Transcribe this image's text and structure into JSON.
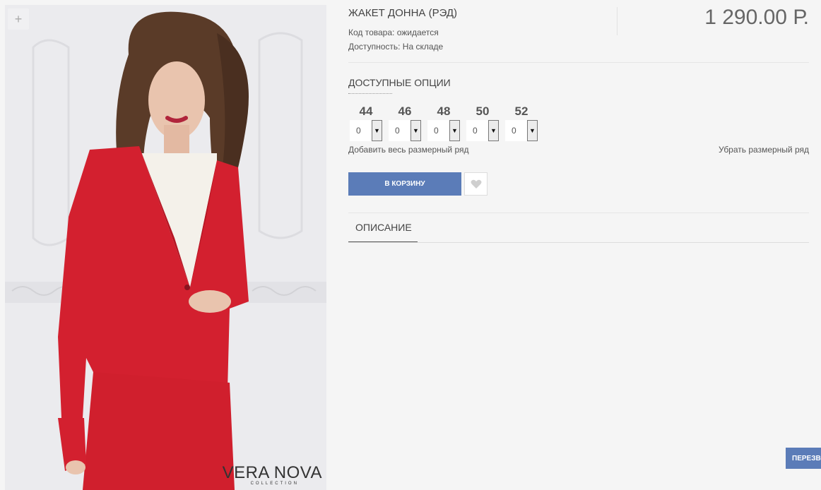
{
  "product": {
    "title": "ЖАКЕТ ДОННА (РЭД)",
    "sku": "Код товара: ожидается",
    "availability": "Доступность: На складе",
    "price": "1 290.00 Р."
  },
  "gallery": {
    "zoom_label": "+",
    "watermark_brand": "VERA NOVA",
    "watermark_sub": "COLLECTION"
  },
  "options": {
    "title": "ДОСТУПНЫЕ ОПЦИИ",
    "sizes": [
      {
        "label": "44",
        "qty": "0"
      },
      {
        "label": "46",
        "qty": "0"
      },
      {
        "label": "48",
        "qty": "0"
      },
      {
        "label": "50",
        "qty": "0"
      },
      {
        "label": "52",
        "qty": "0"
      }
    ],
    "add_all_label": "Добавить весь размерный ряд",
    "remove_all_label": "Убрать размерный ряд"
  },
  "actions": {
    "cart_label": "В КОРЗИНУ"
  },
  "tabs": [
    {
      "label": "ОПИСАНИЕ"
    }
  ],
  "callback": {
    "label": "ПЕРЕЗВОНИТЕ"
  },
  "colors": {
    "accent": "#5b7cb8",
    "jacket": "#d3202f"
  }
}
